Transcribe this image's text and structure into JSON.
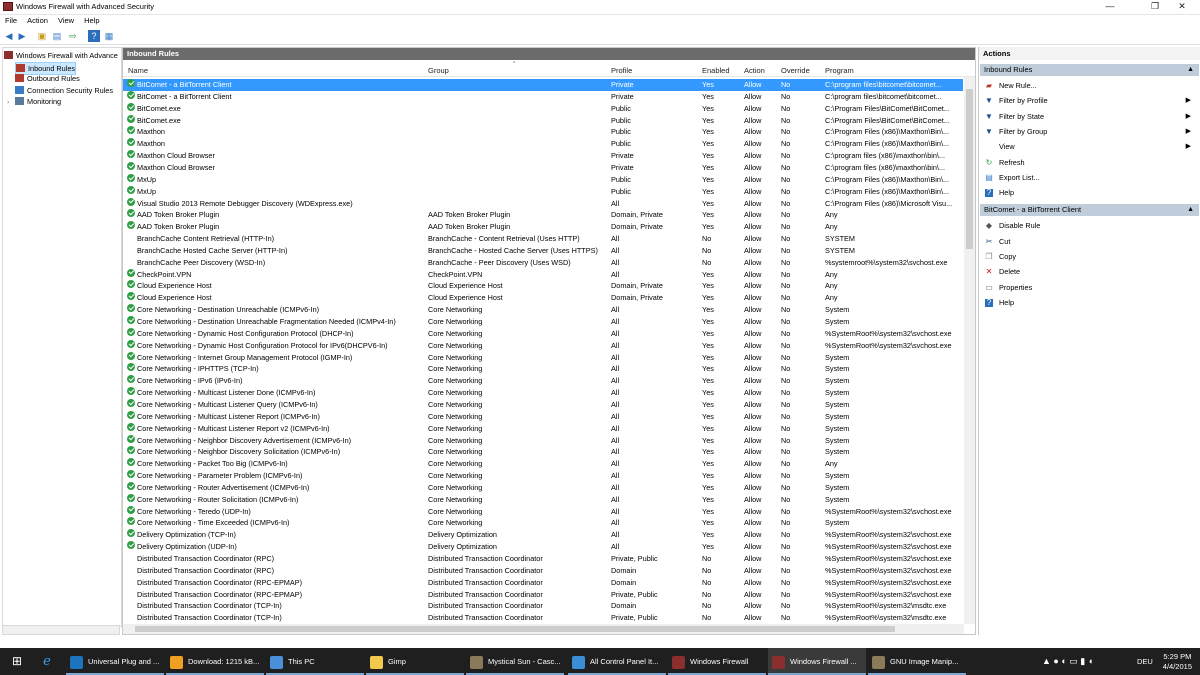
{
  "window": {
    "title": "Windows Firewall with Advanced Security",
    "minimize": "—",
    "maximize": "❐",
    "close": "✕"
  },
  "menu": [
    "File",
    "Action",
    "View",
    "Help"
  ],
  "tree": [
    {
      "label": "Windows Firewall with Advance",
      "icon": "firewall-icon",
      "indent": 0
    },
    {
      "label": "Inbound Rules",
      "icon": "inbound-rules-icon",
      "indent": 1,
      "selected": true
    },
    {
      "label": "Outbound Rules",
      "icon": "outbound-rules-icon",
      "indent": 1
    },
    {
      "label": "Connection Security Rules",
      "icon": "connection-security-icon",
      "indent": 1
    },
    {
      "label": "Monitoring",
      "icon": "monitoring-icon",
      "indent": 1
    }
  ],
  "center": {
    "title": "Inbound Rules",
    "columns": {
      "name": "Name",
      "group": "Group",
      "profile": "Profile",
      "enabled": "Enabled",
      "action": "Action",
      "override": "Override",
      "program": "Program"
    },
    "rows": [
      {
        "name": "BitComet - a BitTorrent Client",
        "group": "",
        "profile": "Private",
        "enabled": "Yes",
        "action": "Allow",
        "override": "No",
        "program": "C:\\program files\\bitcomet\\bitcomet...",
        "on": true,
        "selected": true
      },
      {
        "name": "BitComet - a BitTorrent Client",
        "group": "",
        "profile": "Private",
        "enabled": "Yes",
        "action": "Allow",
        "override": "No",
        "program": "C:\\program files\\bitcomet\\bitcomet...",
        "on": true
      },
      {
        "name": "BitComet.exe",
        "group": "",
        "profile": "Public",
        "enabled": "Yes",
        "action": "Allow",
        "override": "No",
        "program": "C:\\Program Files\\BitComet\\BitComet...",
        "on": true
      },
      {
        "name": "BitComet.exe",
        "group": "",
        "profile": "Public",
        "enabled": "Yes",
        "action": "Allow",
        "override": "No",
        "program": "C:\\Program Files\\BitComet\\BitComet...",
        "on": true
      },
      {
        "name": "Maxthon",
        "group": "",
        "profile": "Public",
        "enabled": "Yes",
        "action": "Allow",
        "override": "No",
        "program": "C:\\Program Files (x86)\\Maxthon\\Bin\\...",
        "on": true
      },
      {
        "name": "Maxthon",
        "group": "",
        "profile": "Public",
        "enabled": "Yes",
        "action": "Allow",
        "override": "No",
        "program": "C:\\Program Files (x86)\\Maxthon\\Bin\\...",
        "on": true
      },
      {
        "name": "Maxthon Cloud Browser",
        "group": "",
        "profile": "Private",
        "enabled": "Yes",
        "action": "Allow",
        "override": "No",
        "program": "C:\\program files (x86)\\maxthon\\bin\\...",
        "on": true
      },
      {
        "name": "Maxthon Cloud Browser",
        "group": "",
        "profile": "Private",
        "enabled": "Yes",
        "action": "Allow",
        "override": "No",
        "program": "C:\\program files (x86)\\maxthon\\bin\\...",
        "on": true
      },
      {
        "name": "MxUp",
        "group": "",
        "profile": "Public",
        "enabled": "Yes",
        "action": "Allow",
        "override": "No",
        "program": "C:\\Program Files (x86)\\Maxthon\\Bin\\...",
        "on": true
      },
      {
        "name": "MxUp",
        "group": "",
        "profile": "Public",
        "enabled": "Yes",
        "action": "Allow",
        "override": "No",
        "program": "C:\\Program Files (x86)\\Maxthon\\Bin\\...",
        "on": true
      },
      {
        "name": "Visual Studio 2013 Remote Debugger Discovery (WDExpress.exe)",
        "group": "",
        "profile": "All",
        "enabled": "Yes",
        "action": "Allow",
        "override": "No",
        "program": "C:\\Program Files (x86)\\Microsoft Visu...",
        "on": true
      },
      {
        "name": "AAD Token Broker Plugin",
        "group": "AAD Token Broker Plugin",
        "profile": "Domain, Private",
        "enabled": "Yes",
        "action": "Allow",
        "override": "No",
        "program": "Any",
        "on": true
      },
      {
        "name": "AAD Token Broker Plugin",
        "group": "AAD Token Broker Plugin",
        "profile": "Domain, Private",
        "enabled": "Yes",
        "action": "Allow",
        "override": "No",
        "program": "Any",
        "on": true
      },
      {
        "name": "BranchCache Content Retrieval (HTTP-In)",
        "group": "BranchCache - Content Retrieval (Uses HTTP)",
        "profile": "All",
        "enabled": "No",
        "action": "Allow",
        "override": "No",
        "program": "SYSTEM",
        "on": false
      },
      {
        "name": "BranchCache Hosted Cache Server (HTTP-In)",
        "group": "BranchCache - Hosted Cache Server (Uses HTTPS)",
        "profile": "All",
        "enabled": "No",
        "action": "Allow",
        "override": "No",
        "program": "SYSTEM",
        "on": false
      },
      {
        "name": "BranchCache Peer Discovery (WSD-In)",
        "group": "BranchCache - Peer Discovery (Uses WSD)",
        "profile": "All",
        "enabled": "No",
        "action": "Allow",
        "override": "No",
        "program": "%systemroot%\\system32\\svchost.exe",
        "on": false
      },
      {
        "name": "CheckPoint.VPN",
        "group": "CheckPoint.VPN",
        "profile": "All",
        "enabled": "Yes",
        "action": "Allow",
        "override": "No",
        "program": "Any",
        "on": true
      },
      {
        "name": "Cloud Experience Host",
        "group": "Cloud Experience Host",
        "profile": "Domain, Private",
        "enabled": "Yes",
        "action": "Allow",
        "override": "No",
        "program": "Any",
        "on": true
      },
      {
        "name": "Cloud Experience Host",
        "group": "Cloud Experience Host",
        "profile": "Domain, Private",
        "enabled": "Yes",
        "action": "Allow",
        "override": "No",
        "program": "Any",
        "on": true
      },
      {
        "name": "Core Networking - Destination Unreachable (ICMPv6-In)",
        "group": "Core Networking",
        "profile": "All",
        "enabled": "Yes",
        "action": "Allow",
        "override": "No",
        "program": "System",
        "on": true
      },
      {
        "name": "Core Networking - Destination Unreachable Fragmentation Needed (ICMPv4-In)",
        "group": "Core Networking",
        "profile": "All",
        "enabled": "Yes",
        "action": "Allow",
        "override": "No",
        "program": "System",
        "on": true
      },
      {
        "name": "Core Networking - Dynamic Host Configuration Protocol (DHCP-In)",
        "group": "Core Networking",
        "profile": "All",
        "enabled": "Yes",
        "action": "Allow",
        "override": "No",
        "program": "%SystemRoot%\\system32\\svchost.exe",
        "on": true
      },
      {
        "name": "Core Networking - Dynamic Host Configuration Protocol for IPv6(DHCPV6-In)",
        "group": "Core Networking",
        "profile": "All",
        "enabled": "Yes",
        "action": "Allow",
        "override": "No",
        "program": "%SystemRoot%\\system32\\svchost.exe",
        "on": true
      },
      {
        "name": "Core Networking - Internet Group Management Protocol (IGMP-In)",
        "group": "Core Networking",
        "profile": "All",
        "enabled": "Yes",
        "action": "Allow",
        "override": "No",
        "program": "System",
        "on": true
      },
      {
        "name": "Core Networking - IPHTTPS (TCP-In)",
        "group": "Core Networking",
        "profile": "All",
        "enabled": "Yes",
        "action": "Allow",
        "override": "No",
        "program": "System",
        "on": true
      },
      {
        "name": "Core Networking - IPv6 (IPv6-In)",
        "group": "Core Networking",
        "profile": "All",
        "enabled": "Yes",
        "action": "Allow",
        "override": "No",
        "program": "System",
        "on": true
      },
      {
        "name": "Core Networking - Multicast Listener Done (ICMPv6-In)",
        "group": "Core Networking",
        "profile": "All",
        "enabled": "Yes",
        "action": "Allow",
        "override": "No",
        "program": "System",
        "on": true
      },
      {
        "name": "Core Networking - Multicast Listener Query (ICMPv6-In)",
        "group": "Core Networking",
        "profile": "All",
        "enabled": "Yes",
        "action": "Allow",
        "override": "No",
        "program": "System",
        "on": true
      },
      {
        "name": "Core Networking - Multicast Listener Report (ICMPv6-In)",
        "group": "Core Networking",
        "profile": "All",
        "enabled": "Yes",
        "action": "Allow",
        "override": "No",
        "program": "System",
        "on": true
      },
      {
        "name": "Core Networking - Multicast Listener Report v2 (ICMPv6-In)",
        "group": "Core Networking",
        "profile": "All",
        "enabled": "Yes",
        "action": "Allow",
        "override": "No",
        "program": "System",
        "on": true
      },
      {
        "name": "Core Networking - Neighbor Discovery Advertisement (ICMPv6-In)",
        "group": "Core Networking",
        "profile": "All",
        "enabled": "Yes",
        "action": "Allow",
        "override": "No",
        "program": "System",
        "on": true
      },
      {
        "name": "Core Networking - Neighbor Discovery Solicitation (ICMPv6-In)",
        "group": "Core Networking",
        "profile": "All",
        "enabled": "Yes",
        "action": "Allow",
        "override": "No",
        "program": "System",
        "on": true
      },
      {
        "name": "Core Networking - Packet Too Big (ICMPv6-In)",
        "group": "Core Networking",
        "profile": "All",
        "enabled": "Yes",
        "action": "Allow",
        "override": "No",
        "program": "Any",
        "on": true
      },
      {
        "name": "Core Networking - Parameter Problem (ICMPv6-In)",
        "group": "Core Networking",
        "profile": "All",
        "enabled": "Yes",
        "action": "Allow",
        "override": "No",
        "program": "System",
        "on": true
      },
      {
        "name": "Core Networking - Router Advertisement (ICMPv6-In)",
        "group": "Core Networking",
        "profile": "All",
        "enabled": "Yes",
        "action": "Allow",
        "override": "No",
        "program": "System",
        "on": true
      },
      {
        "name": "Core Networking - Router Solicitation (ICMPv6-In)",
        "group": "Core Networking",
        "profile": "All",
        "enabled": "Yes",
        "action": "Allow",
        "override": "No",
        "program": "System",
        "on": true
      },
      {
        "name": "Core Networking - Teredo (UDP-In)",
        "group": "Core Networking",
        "profile": "All",
        "enabled": "Yes",
        "action": "Allow",
        "override": "No",
        "program": "%SystemRoot%\\system32\\svchost.exe",
        "on": true
      },
      {
        "name": "Core Networking - Time Exceeded (ICMPv6-In)",
        "group": "Core Networking",
        "profile": "All",
        "enabled": "Yes",
        "action": "Allow",
        "override": "No",
        "program": "System",
        "on": true
      },
      {
        "name": "Delivery Optimization (TCP-In)",
        "group": "Delivery Optimization",
        "profile": "All",
        "enabled": "Yes",
        "action": "Allow",
        "override": "No",
        "program": "%SystemRoot%\\system32\\svchost.exe",
        "on": true
      },
      {
        "name": "Delivery Optimization (UDP-In)",
        "group": "Delivery Optimization",
        "profile": "All",
        "enabled": "Yes",
        "action": "Allow",
        "override": "No",
        "program": "%SystemRoot%\\system32\\svchost.exe",
        "on": true
      },
      {
        "name": "Distributed Transaction Coordinator (RPC)",
        "group": "Distributed Transaction Coordinator",
        "profile": "Private, Public",
        "enabled": "No",
        "action": "Allow",
        "override": "No",
        "program": "%SystemRoot%\\system32\\svchost.exe",
        "on": false
      },
      {
        "name": "Distributed Transaction Coordinator (RPC)",
        "group": "Distributed Transaction Coordinator",
        "profile": "Domain",
        "enabled": "No",
        "action": "Allow",
        "override": "No",
        "program": "%SystemRoot%\\system32\\svchost.exe",
        "on": false
      },
      {
        "name": "Distributed Transaction Coordinator (RPC-EPMAP)",
        "group": "Distributed Transaction Coordinator",
        "profile": "Domain",
        "enabled": "No",
        "action": "Allow",
        "override": "No",
        "program": "%SystemRoot%\\system32\\svchost.exe",
        "on": false
      },
      {
        "name": "Distributed Transaction Coordinator (RPC-EPMAP)",
        "group": "Distributed Transaction Coordinator",
        "profile": "Private, Public",
        "enabled": "No",
        "action": "Allow",
        "override": "No",
        "program": "%SystemRoot%\\system32\\svchost.exe",
        "on": false
      },
      {
        "name": "Distributed Transaction Coordinator (TCP-In)",
        "group": "Distributed Transaction Coordinator",
        "profile": "Domain",
        "enabled": "No",
        "action": "Allow",
        "override": "No",
        "program": "%SystemRoot%\\system32\\msdtc.exe",
        "on": false
      },
      {
        "name": "Distributed Transaction Coordinator (TCP-In)",
        "group": "Distributed Transaction Coordinator",
        "profile": "Private, Public",
        "enabled": "No",
        "action": "Allow",
        "override": "No",
        "program": "%SystemRoot%\\system32\\msdtc.exe",
        "on": false
      }
    ]
  },
  "actions": {
    "title": "Actions",
    "section1": {
      "title": "Inbound Rules",
      "items": [
        {
          "label": "New Rule...",
          "icon": "new-rule-icon",
          "arrow": false
        },
        {
          "label": "Filter by Profile",
          "icon": "filter-icon",
          "arrow": true
        },
        {
          "label": "Filter by State",
          "icon": "filter-icon",
          "arrow": true
        },
        {
          "label": "Filter by Group",
          "icon": "filter-icon",
          "arrow": true
        },
        {
          "label": "View",
          "icon": "",
          "arrow": true
        },
        {
          "label": "Refresh",
          "icon": "refresh-icon",
          "arrow": false
        },
        {
          "label": "Export List...",
          "icon": "export-icon",
          "arrow": false
        },
        {
          "label": "Help",
          "icon": "help-icon",
          "arrow": false
        }
      ]
    },
    "section2": {
      "title": "BitComet - a BitTorrent Client",
      "items": [
        {
          "label": "Disable Rule",
          "icon": "disable-rule-icon",
          "arrow": false
        },
        {
          "label": "Cut",
          "icon": "cut-icon",
          "arrow": false
        },
        {
          "label": "Copy",
          "icon": "copy-icon",
          "arrow": false
        },
        {
          "label": "Delete",
          "icon": "delete-icon",
          "arrow": false
        },
        {
          "label": "Properties",
          "icon": "properties-icon",
          "arrow": false
        },
        {
          "label": "Help",
          "icon": "help-icon",
          "arrow": false
        }
      ]
    }
  },
  "taskbar": {
    "items": [
      {
        "label": "Universal Plug and ...",
        "icon": "upnp-app-icon",
        "color": "#1e73be"
      },
      {
        "label": "Download: 1215 kB...",
        "icon": "download-app-icon",
        "color": "#f0a020"
      },
      {
        "label": "This PC",
        "icon": "this-pc-icon",
        "color": "#4a90d9"
      },
      {
        "label": "Gimp",
        "icon": "folder-icon",
        "color": "#f2c94c"
      },
      {
        "label": "Mystical Sun - Casc...",
        "icon": "gimp-icon",
        "color": "#8a7a5a"
      },
      {
        "label": "All Control Panel It...",
        "icon": "control-panel-icon",
        "color": "#3a8ed6"
      },
      {
        "label": "Windows Firewall",
        "icon": "firewall-app-icon",
        "color": "#8b2e2e"
      },
      {
        "label": "Windows Firewall ...",
        "icon": "firewall-app-icon",
        "color": "#8b2e2e"
      },
      {
        "label": "GNU Image Manip...",
        "icon": "gimp-icon",
        "color": "#8a7a5a"
      }
    ],
    "tray": {
      "lang": "DEU",
      "time": "5:29 PM",
      "date": "4/4/2015"
    }
  },
  "colors": {
    "selection": "#3399ff",
    "header": "#6b6b6b",
    "taskbar": "#1f1f1f",
    "enabled_check": "#2f9e44"
  }
}
